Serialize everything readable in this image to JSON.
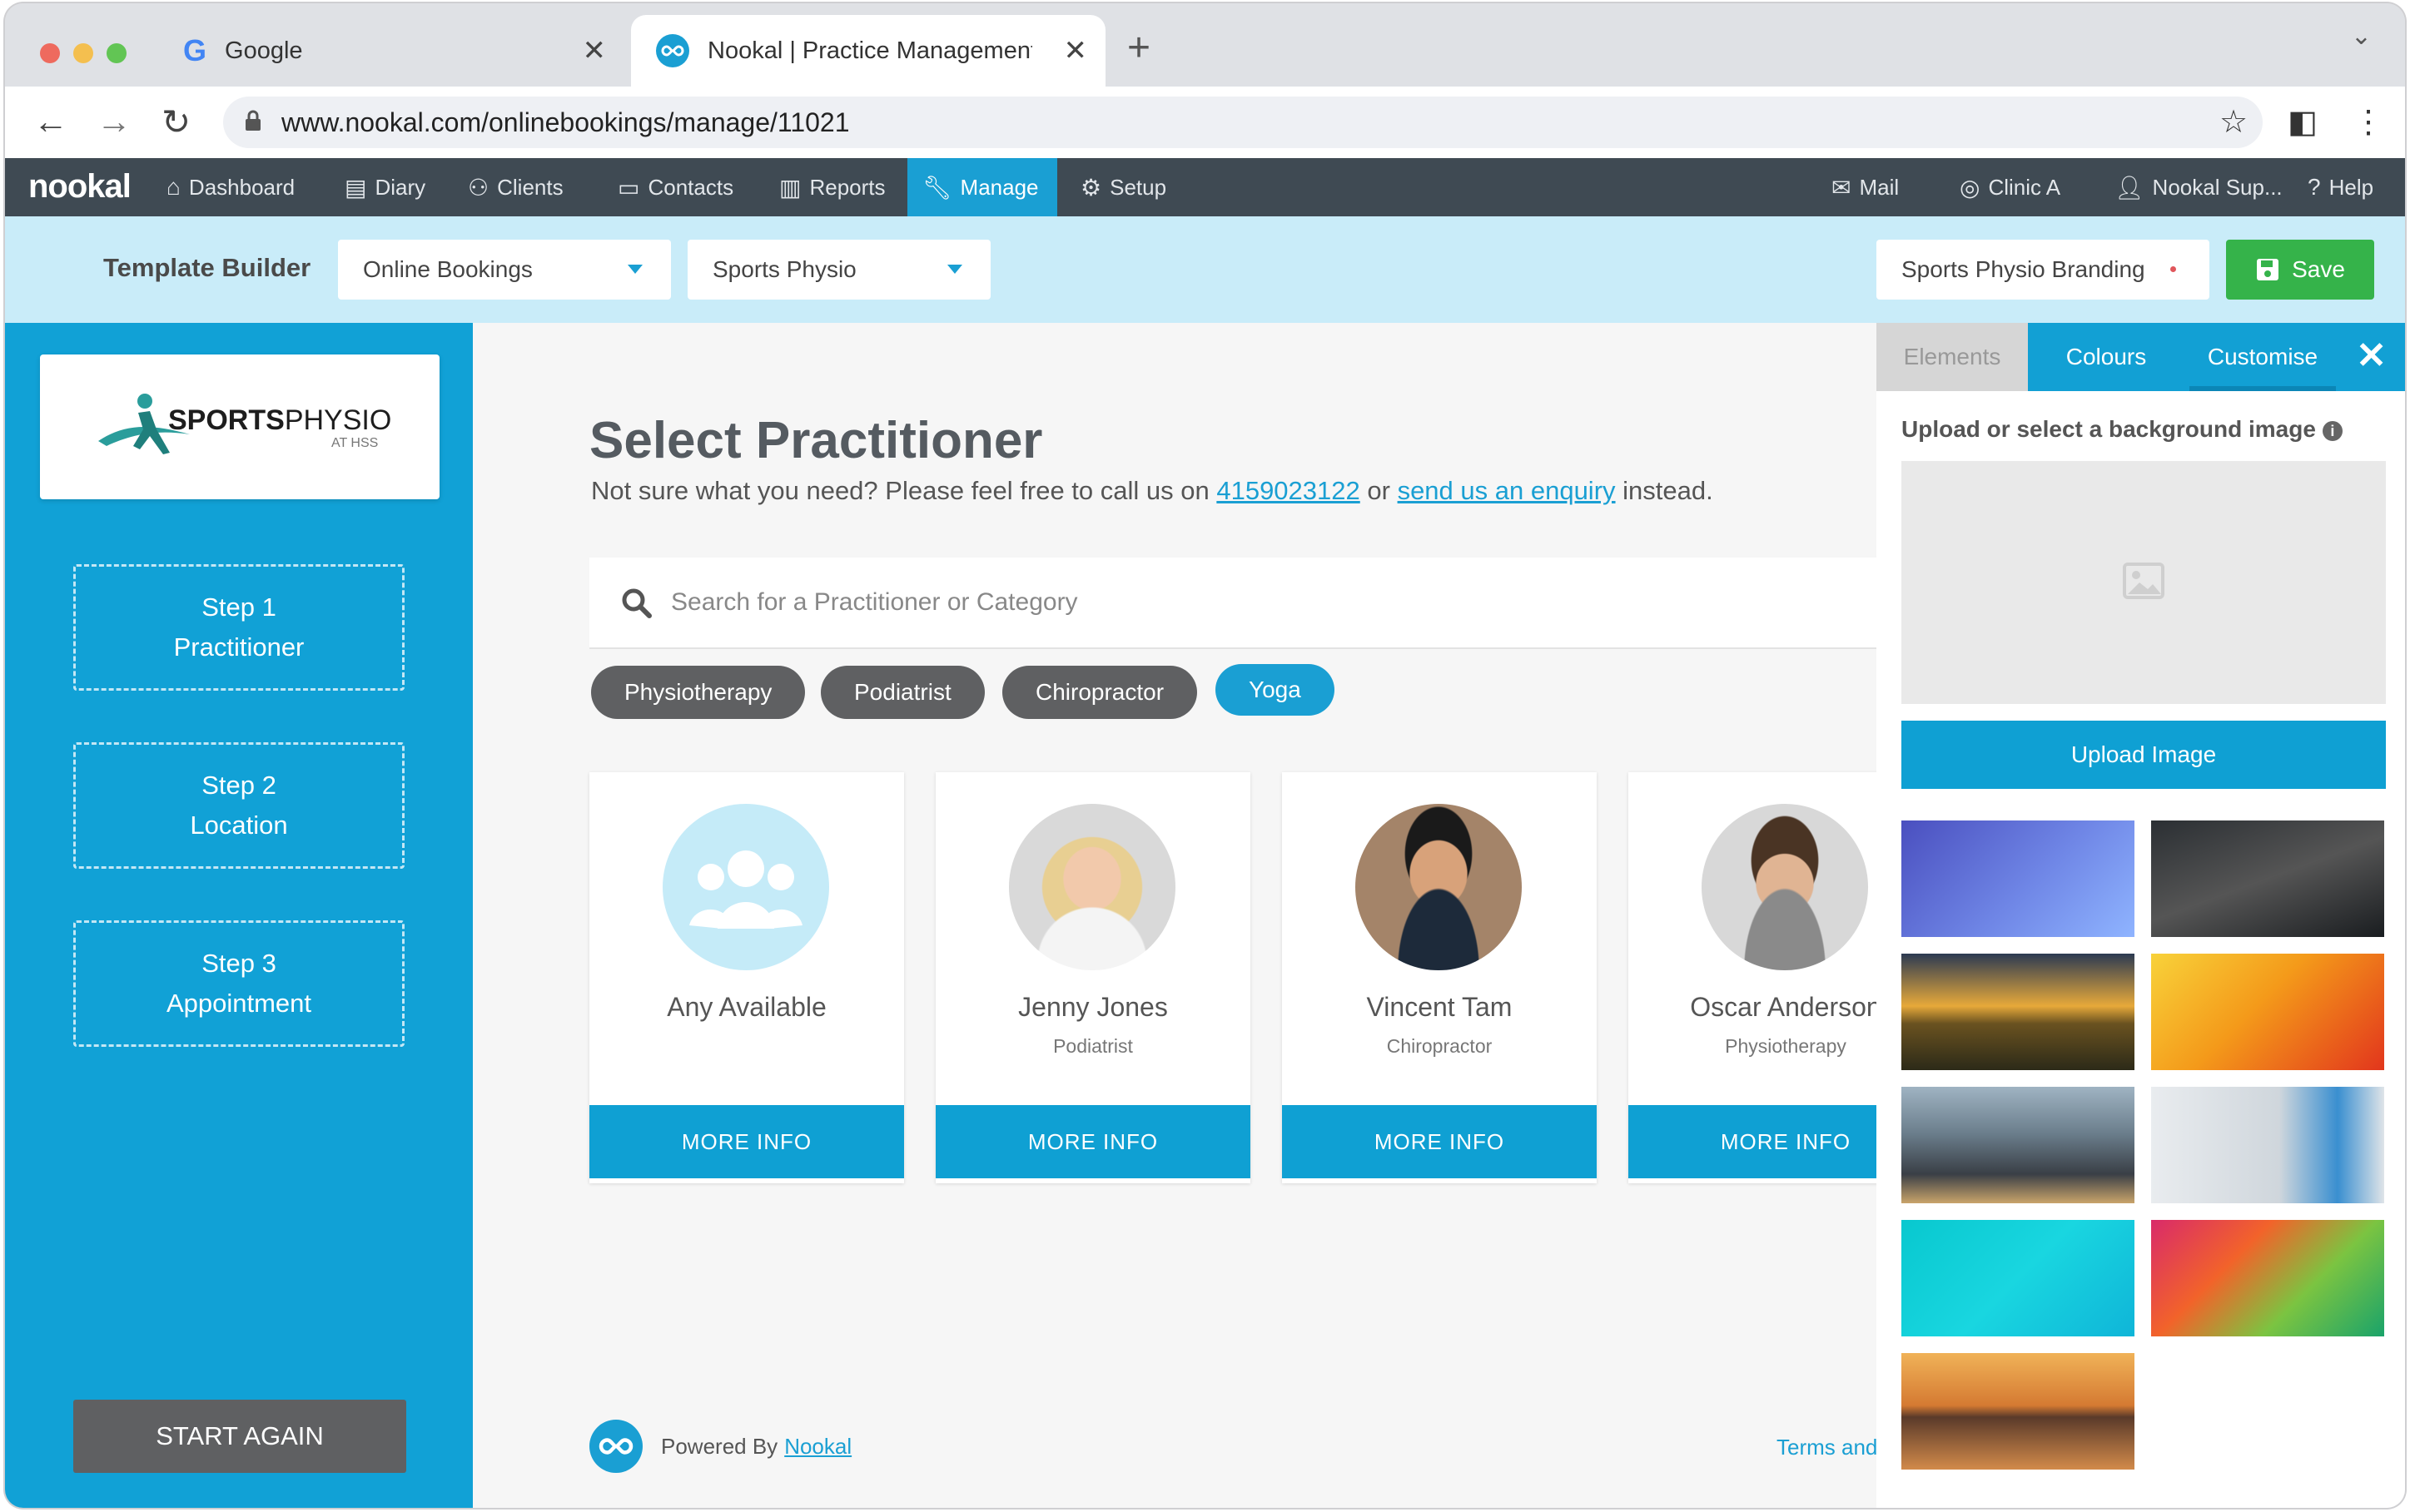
{
  "browser": {
    "tabs": [
      {
        "title": "Google",
        "icon": "google-g-icon",
        "active": false
      },
      {
        "title": "Nookal | Practice Management",
        "icon": "nookal-infinity-icon",
        "active": true
      }
    ],
    "url": "www.nookal.com/onlinebookings/manage/11021"
  },
  "appnav": {
    "logo": "nookal",
    "left_items": [
      {
        "label": "Dashboard",
        "icon": "home-icon"
      },
      {
        "label": "Diary",
        "icon": "book-icon"
      },
      {
        "label": "Clients",
        "icon": "users-icon"
      },
      {
        "label": "Contacts",
        "icon": "id-card-icon"
      },
      {
        "label": "Reports",
        "icon": "bar-chart-icon"
      },
      {
        "label": "Manage",
        "icon": "wrench-icon",
        "active": true
      },
      {
        "label": "Setup",
        "icon": "gear-icon"
      }
    ],
    "right_items": [
      {
        "label": "Mail",
        "icon": "mail-icon"
      },
      {
        "label": "Clinic A",
        "icon": "compass-icon"
      },
      {
        "label": "Nookal Sup...",
        "icon": "user-icon"
      },
      {
        "label": "Help",
        "icon": "help-icon"
      }
    ]
  },
  "builder": {
    "title": "Template Builder",
    "dropdown1": "Online Bookings",
    "dropdown2": "Sports Physio",
    "branding": "Sports Physio Branding",
    "save_label": "Save"
  },
  "sidebar": {
    "brand_logo": {
      "word1": "SPORTS",
      "word2": "PHYSIO",
      "tag": "AT HSS"
    },
    "steps": [
      {
        "num": "Step 1",
        "label": "Practitioner"
      },
      {
        "num": "Step 2",
        "label": "Location"
      },
      {
        "num": "Step 3",
        "label": "Appointment"
      }
    ],
    "start_again": "START AGAIN"
  },
  "main": {
    "heading": "Select Practitioner",
    "sub_before": "Not sure what you need? Please feel free to call us on ",
    "phone": "4159023122",
    "sub_mid": " or ",
    "enquiry_link": "send us an enquiry",
    "sub_after": " instead.",
    "search_placeholder": "Search for a Practitioner or Category",
    "categories": [
      "Physiotherapy",
      "Podiatrist",
      "Chiropractor",
      "Yoga"
    ],
    "active_category": "Yoga",
    "practitioners": [
      {
        "name": "Any Available",
        "role": ""
      },
      {
        "name": "Jenny Jones",
        "role": "Podiatrist"
      },
      {
        "name": "Vincent Tam",
        "role": "Chiropractor"
      },
      {
        "name": "Oscar Anderson",
        "role": "Physiotherapy"
      }
    ],
    "more_info": "MORE INFO",
    "powered_by": "Powered By",
    "powered_link": "Nookal",
    "terms": "Terms and"
  },
  "panel": {
    "tabs": [
      "Elements",
      "Colours",
      "Customise"
    ],
    "active_tab": "Customise",
    "label": "Upload or select a background image",
    "upload_button": "Upload Image"
  },
  "colors": {
    "accent": "#1a9fd3",
    "nav_bg": "#3f4a53",
    "builder_bar": "#c9ecf9",
    "save_green": "#35b34a",
    "pill_dark": "#5f6062"
  }
}
